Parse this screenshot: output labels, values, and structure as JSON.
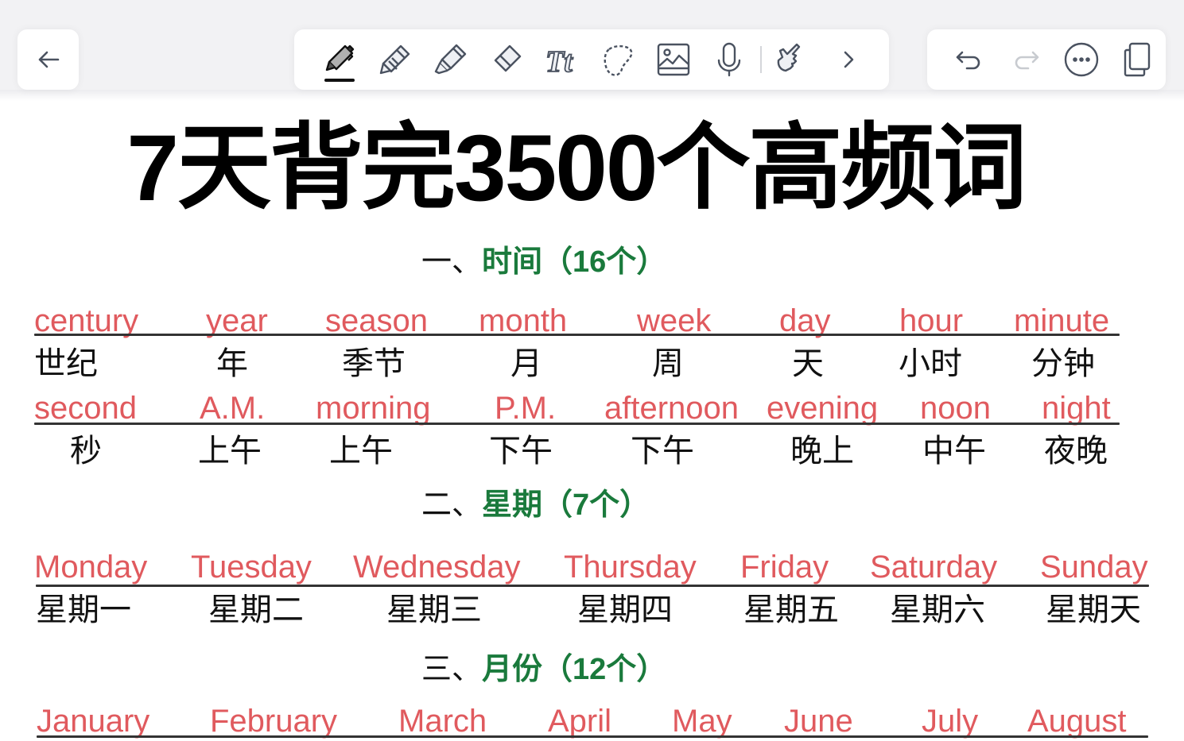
{
  "toolbar": {
    "back_icon": "arrow-left-icon",
    "tools": [
      {
        "name": "pen",
        "icon": "pen-icon",
        "active": true
      },
      {
        "name": "pencil",
        "icon": "pencil-icon",
        "active": false
      },
      {
        "name": "highlighter",
        "icon": "highlighter-icon",
        "active": false
      },
      {
        "name": "eraser",
        "icon": "eraser-icon",
        "active": false
      },
      {
        "name": "text",
        "icon": "text-icon",
        "label": "Tt",
        "active": false
      },
      {
        "name": "lasso",
        "icon": "lasso-icon",
        "active": false
      },
      {
        "name": "image",
        "icon": "image-icon",
        "active": false
      },
      {
        "name": "microphone",
        "icon": "microphone-icon",
        "active": false
      },
      {
        "name": "hand-touch",
        "icon": "hand-pointer-icon",
        "active": false
      },
      {
        "name": "more-tools",
        "icon": "chevron-right-icon",
        "active": false
      }
    ],
    "right": [
      {
        "name": "undo",
        "icon": "undo-icon",
        "enabled": true
      },
      {
        "name": "redo",
        "icon": "redo-icon",
        "enabled": false
      },
      {
        "name": "more",
        "icon": "ellipsis-circle-icon",
        "enabled": true
      },
      {
        "name": "pages",
        "icon": "copy-pages-icon",
        "enabled": true
      }
    ]
  },
  "document": {
    "title": "7天背完3500个高频词",
    "colors": {
      "english": "#e05a5e",
      "section": "#1a7a3c",
      "chinese": "#111111"
    },
    "sections": [
      {
        "number": "一、",
        "name": "时间",
        "count": "（16个）",
        "rows": [
          {
            "english": [
              "century",
              "year",
              "season",
              "month",
              "week",
              "day",
              "hour",
              "minute"
            ],
            "chinese": [
              "世纪",
              "年",
              "季节",
              "月",
              "周",
              "天",
              "小时",
              "分钟"
            ]
          },
          {
            "english": [
              "second",
              "A.M.",
              "morning",
              "P.M.",
              "afternoon",
              "evening",
              "noon",
              "night"
            ],
            "chinese": [
              "秒",
              "上午",
              "上午",
              "下午",
              "下午",
              "晚上",
              "中午",
              "夜晚"
            ]
          }
        ]
      },
      {
        "number": "二、",
        "name": "星期",
        "count": "（7个）",
        "rows": [
          {
            "english": [
              "Monday",
              "Tuesday",
              "Wednesday",
              "Thursday",
              "Friday",
              "Saturday",
              "Sunday"
            ],
            "chinese": [
              "星期一",
              "星期二",
              "星期三",
              "星期四",
              "星期五",
              "星期六",
              "星期天"
            ]
          }
        ]
      },
      {
        "number": "三、",
        "name": "月份",
        "count": "（12个）",
        "rows": [
          {
            "english": [
              "January",
              "February",
              "March",
              "April",
              "May",
              "June",
              "July",
              "August"
            ],
            "chinese": []
          }
        ]
      }
    ]
  }
}
